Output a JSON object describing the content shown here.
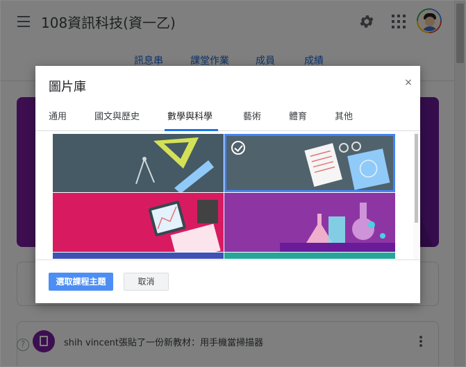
{
  "header": {
    "title": "108資訊科技(資一乙)",
    "icons": [
      "menu-icon",
      "gear-icon",
      "apps-icon",
      "avatar"
    ]
  },
  "course_tabs": [
    "訊息串",
    "課堂作業",
    "成員",
    "成績"
  ],
  "stream": {
    "post_text": "shih vincent張貼了一份新教材：用手機當掃描器"
  },
  "dialog": {
    "title": "圖片庫",
    "close_glyph": "×",
    "tabs": [
      "通用",
      "國文與歷史",
      "數學與科學",
      "藝術",
      "體育",
      "其他"
    ],
    "active_tab": "數學與科學",
    "selected_tile": 2,
    "buttons": {
      "primary": "選取課程主題",
      "secondary": "取消"
    }
  },
  "colors": {
    "accent": "#1a73e8",
    "primary_button": "#4c8ef3",
    "banner": "#7a1fa2",
    "tile_1": "#455a64",
    "tile_2": "#50626c",
    "tile_3": "#d81b60",
    "tile_4": "#8e35a4",
    "tile_5": "#3f51b5",
    "tile_6": "#26a69a"
  }
}
